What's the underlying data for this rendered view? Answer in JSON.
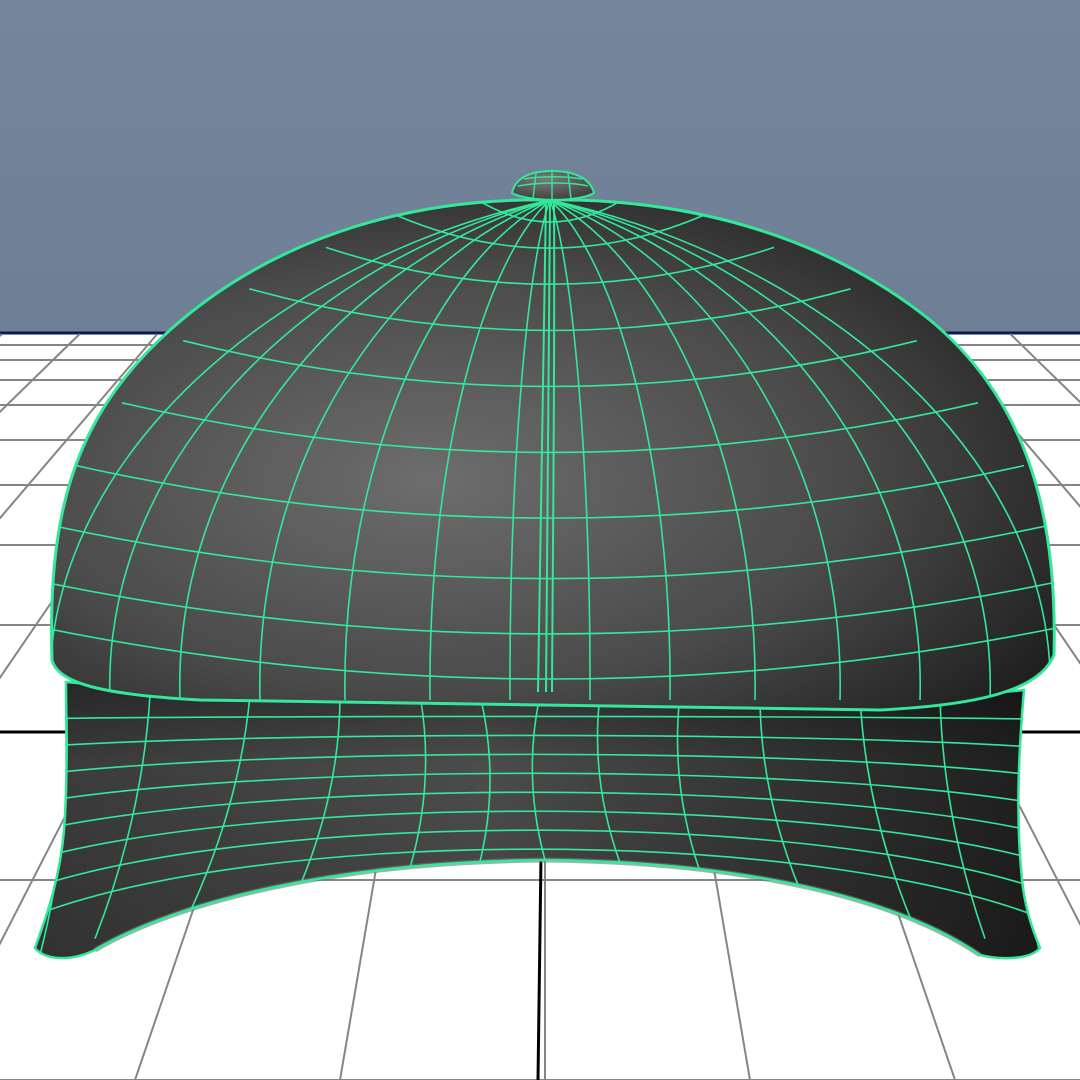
{
  "viewport": {
    "background_top": "#75869c",
    "background_bottom": "#5e7087",
    "grid_plane": "#ffffff",
    "grid_line": "#858585",
    "grid_axis": "#000000",
    "horizon": "#0a1a55"
  },
  "model": {
    "shading": "smooth-shaded-with-wireframe",
    "selected": true,
    "wire_color": "#33e89a",
    "surface_light": "#6d6d6d",
    "surface_dark": "#1a1a1a"
  }
}
